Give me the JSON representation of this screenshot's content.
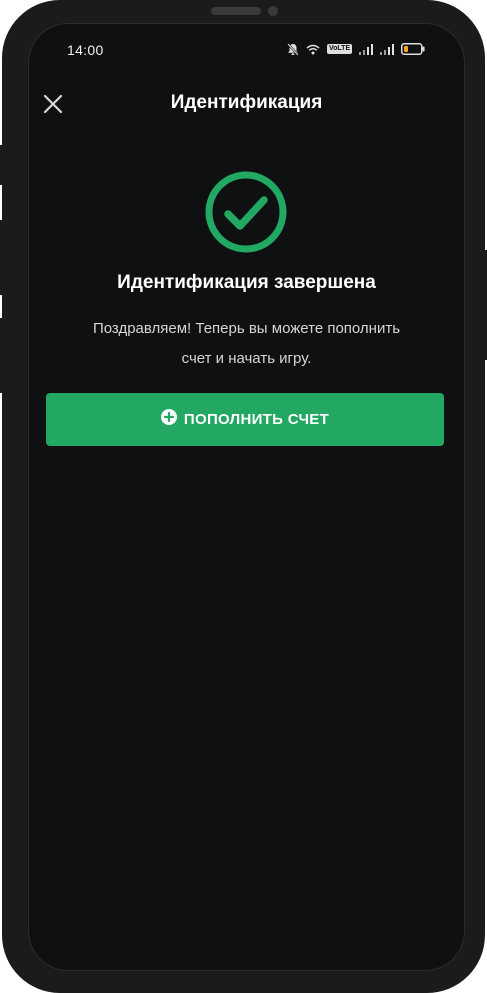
{
  "status_bar": {
    "time": "14:00",
    "volte": "VoLTE",
    "battery_color": "#f5a623"
  },
  "header": {
    "title": "Идентификация",
    "close_icon": "close-icon"
  },
  "success": {
    "icon": "check-circle-icon",
    "title": "Идентификация завершена",
    "line1": "Поздравляем! Теперь вы можете пополнить",
    "line2": "счет и начать игру."
  },
  "deposit_button": {
    "label": "ПОПОЛНИТЬ СЧЕТ",
    "icon": "plus-circle-icon"
  },
  "colors": {
    "accent": "#23a863",
    "background": "#0f1012",
    "text": "#ffffff"
  }
}
